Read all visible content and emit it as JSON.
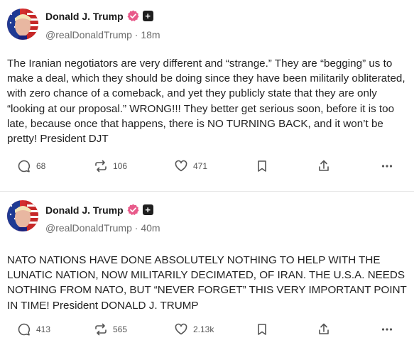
{
  "posts": [
    {
      "author_name": "Donald J. Trump",
      "handle": "@realDonaldTrump",
      "time_sep": " · ",
      "time": "18m",
      "text": "The Iranian negotiators are very different and “strange.” They are “begging” us to make a deal, which they should be doing since they have been militarily obliterated, with zero chance of a comeback, and yet they publicly state that they are only “looking at our proposal.” WRONG!!! They better get serious soon, before it is too late, because once that happens, there is NO TURNING BACK, and it won’t be pretty! President DJT",
      "replies": "68",
      "reposts": "106",
      "likes": "471"
    },
    {
      "author_name": "Donald J. Trump",
      "handle": "@realDonaldTrump",
      "time_sep": " · ",
      "time": "40m",
      "text": "NATO NATIONS HAVE DONE ABSOLUTELY NOTHING TO HELP WITH THE LUNATIC NATION, NOW MILITARILY DECIMATED, OF IRAN. THE U.S.A. NEEDS NOTHING FROM NATO, BUT “NEVER FORGET” THIS VERY IMPORTANT POINT IN TIME! President DONALD J. TRUMP",
      "replies": "413",
      "reposts": "565",
      "likes": "2.13k"
    }
  ],
  "icons": {
    "reply": "reply-icon",
    "repost": "repost-icon",
    "like": "heart-icon",
    "bookmark": "bookmark-icon",
    "share": "share-icon",
    "more": "more-icon",
    "verified": "verified-badge-icon",
    "plus": "plus-badge-icon"
  },
  "colors": {
    "verified_badge": "#e85a8a",
    "text": "#222222",
    "muted": "#6b6b6b"
  }
}
